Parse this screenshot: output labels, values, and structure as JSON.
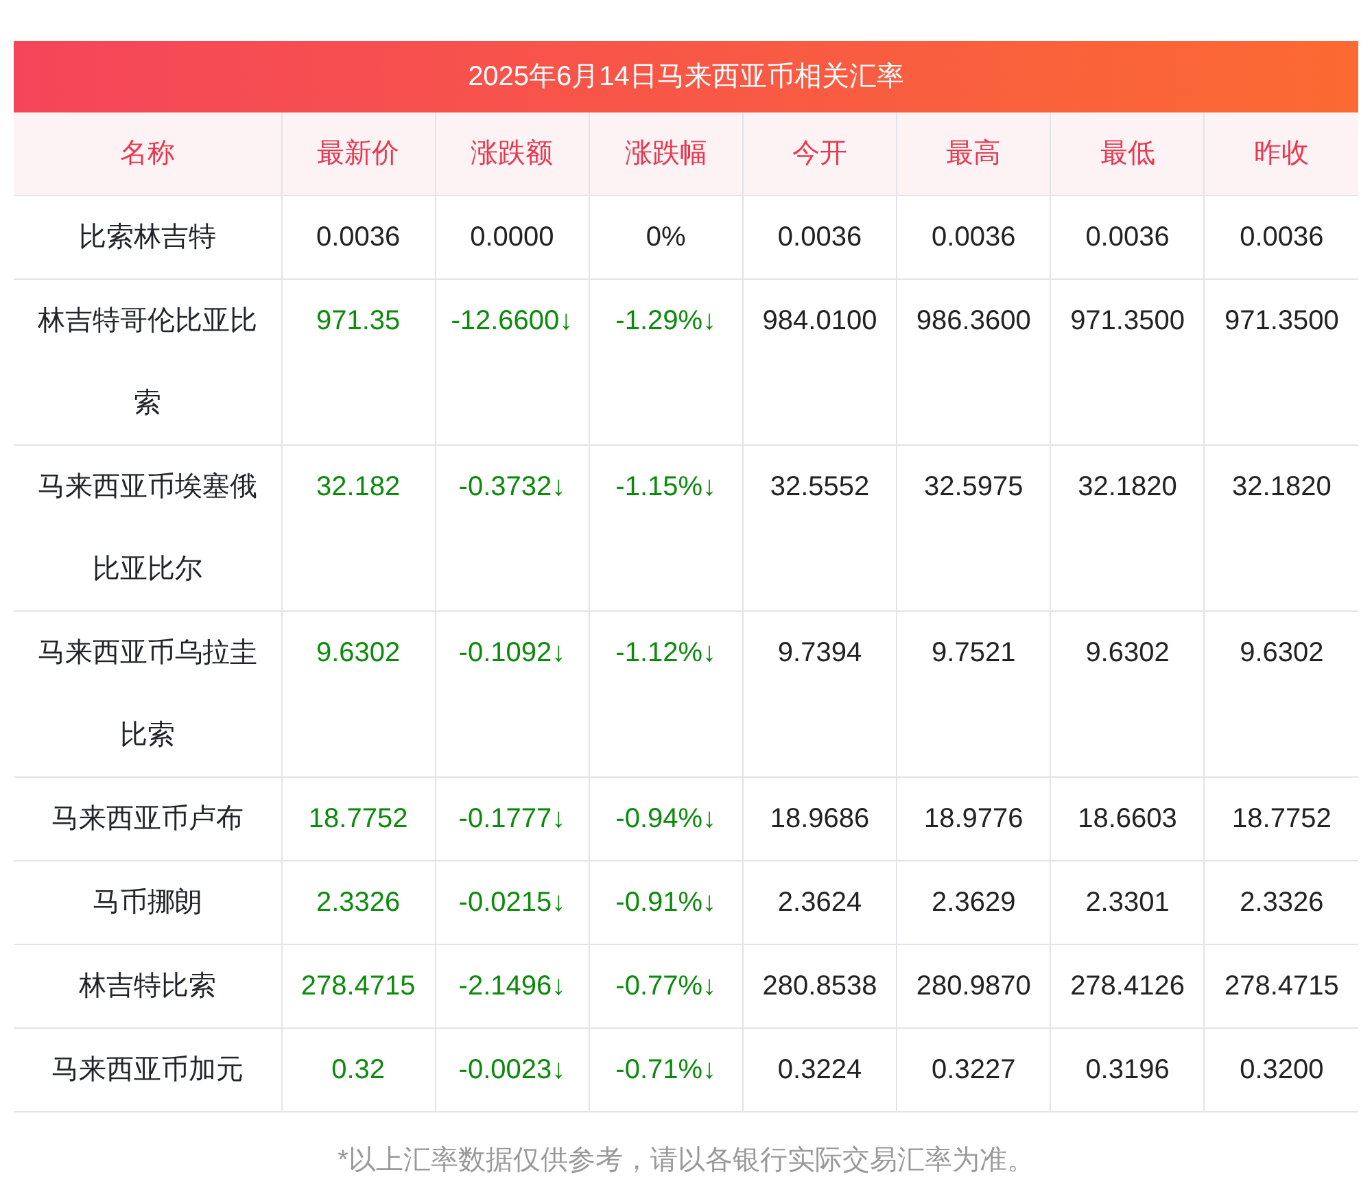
{
  "title": "2025年6月14日马来西亚币相关汇率",
  "columns": [
    "名称",
    "最新价",
    "涨跌额",
    "涨跌幅",
    "今开",
    "最高",
    "最低",
    "昨收"
  ],
  "rows": [
    {
      "name": "比索林吉特",
      "kind": "flat",
      "latest": "0.0036",
      "change": "0.0000",
      "change_pct": "0%",
      "open": "0.0036",
      "high": "0.0036",
      "low": "0.0036",
      "prev_close": "0.0036"
    },
    {
      "name": "林吉特哥伦比亚比索",
      "kind": "down",
      "latest": "971.35",
      "change": "-12.6600↓",
      "change_pct": "-1.29%↓",
      "open": "984.0100",
      "high": "986.3600",
      "low": "971.3500",
      "prev_close": "971.3500"
    },
    {
      "name": "马来西亚币埃塞俄比亚比尔",
      "kind": "down",
      "latest": "32.182",
      "change": "-0.3732↓",
      "change_pct": "-1.15%↓",
      "open": "32.5552",
      "high": "32.5975",
      "low": "32.1820",
      "prev_close": "32.1820"
    },
    {
      "name": "马来西亚币乌拉圭比索",
      "kind": "down",
      "latest": "9.6302",
      "change": "-0.1092↓",
      "change_pct": "-1.12%↓",
      "open": "9.7394",
      "high": "9.7521",
      "low": "9.6302",
      "prev_close": "9.6302"
    },
    {
      "name": "马来西亚币卢布",
      "kind": "down",
      "latest": "18.7752",
      "change": "-0.1777↓",
      "change_pct": "-0.94%↓",
      "open": "18.9686",
      "high": "18.9776",
      "low": "18.6603",
      "prev_close": "18.7752"
    },
    {
      "name": "马币挪朗",
      "kind": "down",
      "latest": "2.3326",
      "change": "-0.0215↓",
      "change_pct": "-0.91%↓",
      "open": "2.3624",
      "high": "2.3629",
      "low": "2.3301",
      "prev_close": "2.3326"
    },
    {
      "name": "林吉特比索",
      "kind": "down",
      "latest": "278.4715",
      "change": "-2.1496↓",
      "change_pct": "-0.77%↓",
      "open": "280.8538",
      "high": "280.9870",
      "low": "278.4126",
      "prev_close": "278.4715"
    },
    {
      "name": "马来西亚币加元",
      "kind": "down",
      "latest": "0.32",
      "change": "-0.0023↓",
      "change_pct": "-0.71%↓",
      "open": "0.3224",
      "high": "0.3227",
      "low": "0.3196",
      "prev_close": "0.3200"
    }
  ],
  "footnote": "*以上汇率数据仅供参考，请以各银行实际交易汇率为准。"
}
